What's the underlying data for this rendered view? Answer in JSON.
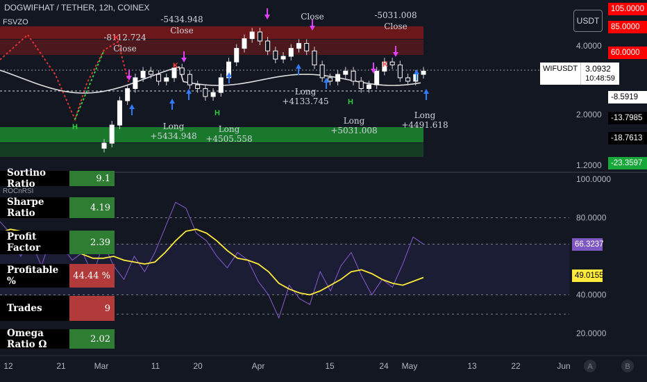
{
  "header": {
    "title": "DOGWIFHAT / TETHER, 12h, COINEX"
  },
  "indicator": {
    "name": "FSVZO",
    "osc_name": "ROCnRSI"
  },
  "currency_button": "USDT",
  "symbol_badge": {
    "name": "WIFUSDT",
    "price": "3.0932",
    "countdown": "10:48:59"
  },
  "price_axis_labels": [
    "4.0000",
    "2.0000",
    "1.2000"
  ],
  "price_badges": [
    {
      "text": "105.0000",
      "bg": "#ff0000",
      "fg": "#ffffff"
    },
    {
      "text": "85.0000",
      "bg": "#ff0000",
      "fg": "#ffffff"
    },
    {
      "text": "60.0000",
      "bg": "#ff0000",
      "fg": "#ffffff"
    },
    {
      "text": "-8.5919",
      "bg": "#ffffff",
      "fg": "#000000"
    },
    {
      "text": "-13.7985",
      "bg": "#000000",
      "fg": "#ffffff"
    },
    {
      "text": "-18.7613",
      "bg": "#000000",
      "fg": "#ffffff"
    },
    {
      "text": "-23.3597",
      "bg": "#18a83a",
      "fg": "#ffffff"
    }
  ],
  "osc_axis_labels": [
    "100.0000",
    "80.0000",
    "40.0000",
    "20.0000"
  ],
  "osc_badges": [
    {
      "text": "66.3237",
      "bg": "#7e57c2",
      "fg": "#ffffff"
    },
    {
      "text": "49.0155",
      "bg": "#ffeb3b",
      "fg": "#000000"
    }
  ],
  "time_axis": [
    "12",
    "21",
    "Mar",
    "11",
    "20",
    "Apr",
    "15",
    "24",
    "May",
    "13",
    "22",
    "Jun"
  ],
  "time_axis_extra": [
    "A",
    "B"
  ],
  "trade_labels": [
    {
      "type": "close",
      "text": "-5434.948",
      "sub": "Close"
    },
    {
      "type": "close",
      "text": "-8112.724",
      "sub": "Close"
    },
    {
      "type": "close",
      "text": "-5031.008",
      "sub": "Close"
    },
    {
      "type": "close",
      "text": "",
      "sub": "Close"
    },
    {
      "type": "long",
      "text": "+5434.948",
      "sub": "Long"
    },
    {
      "type": "long",
      "text": "+4505.558",
      "sub": "Long"
    },
    {
      "type": "long",
      "text": "+4133.745",
      "sub": "Long"
    },
    {
      "type": "long",
      "text": "+5031.008",
      "sub": "Long"
    },
    {
      "type": "long",
      "text": "+4491.618",
      "sub": "Long"
    }
  ],
  "stats_table": [
    {
      "label": "Sortino Ratio",
      "value": "9.1",
      "color": "#2e7d32"
    },
    {
      "label": "Sharpe Ratio",
      "value": "4.19",
      "color": "#2e7d32"
    },
    {
      "label": "Profit Factor",
      "value": "2.39",
      "color": "#2e7d32"
    },
    {
      "label": "Profitable %",
      "value": "44.44 %",
      "color": "#b23a3a"
    },
    {
      "label": "Trades",
      "value": "9",
      "color": "#b23a3a"
    },
    {
      "label": "Omega Ratio Ω",
      "value": "2.02",
      "color": "#2e7d32"
    }
  ],
  "chart_data": {
    "type": "line",
    "price": {
      "y_ticks": [
        4.0,
        2.0,
        1.2
      ],
      "close": [
        1.5,
        1.8,
        2.3,
        2.6,
        2.9,
        3.1,
        3.0,
        2.8,
        2.9,
        3.2,
        3.0,
        2.7,
        2.6,
        2.4,
        2.5,
        2.9,
        3.4,
        3.9,
        4.3,
        4.6,
        4.2,
        3.8,
        3.5,
        3.6,
        3.9,
        4.1,
        3.8,
        3.3,
        2.9,
        2.8,
        3.0,
        3.1,
        2.8,
        2.6,
        2.7,
        3.1,
        3.4,
        3.3,
        2.9,
        2.8,
        3.0,
        3.1
      ],
      "last": 3.0932
    },
    "oscillator": {
      "y_range": [
        20,
        100
      ],
      "bands": [
        80,
        66.3,
        40,
        30
      ],
      "series": [
        {
          "name": "ROCnRSI",
          "color": "#7e57c2",
          "values": [
            78,
            72,
            60,
            68,
            55,
            70,
            65,
            58,
            62,
            50,
            67,
            55,
            48,
            60,
            52,
            62,
            75,
            88,
            85,
            72,
            68,
            60,
            54,
            62,
            58,
            47,
            40,
            28,
            45,
            38,
            35,
            52,
            42,
            55,
            62,
            50,
            40,
            48,
            44,
            56,
            70,
            66.3
          ]
        },
        {
          "name": "Signal",
          "color": "#ffeb3b",
          "values": [
            72,
            74,
            73,
            70,
            67,
            66,
            64,
            63,
            61,
            59,
            59,
            60,
            58,
            57,
            56,
            57,
            62,
            68,
            73,
            74,
            72,
            68,
            63,
            59,
            58,
            56,
            52,
            46,
            43,
            41,
            40,
            42,
            45,
            48,
            52,
            53,
            51,
            48,
            46,
            45,
            47,
            49.0
          ]
        }
      ],
      "last_values": [
        66.3237,
        49.0155
      ]
    }
  }
}
